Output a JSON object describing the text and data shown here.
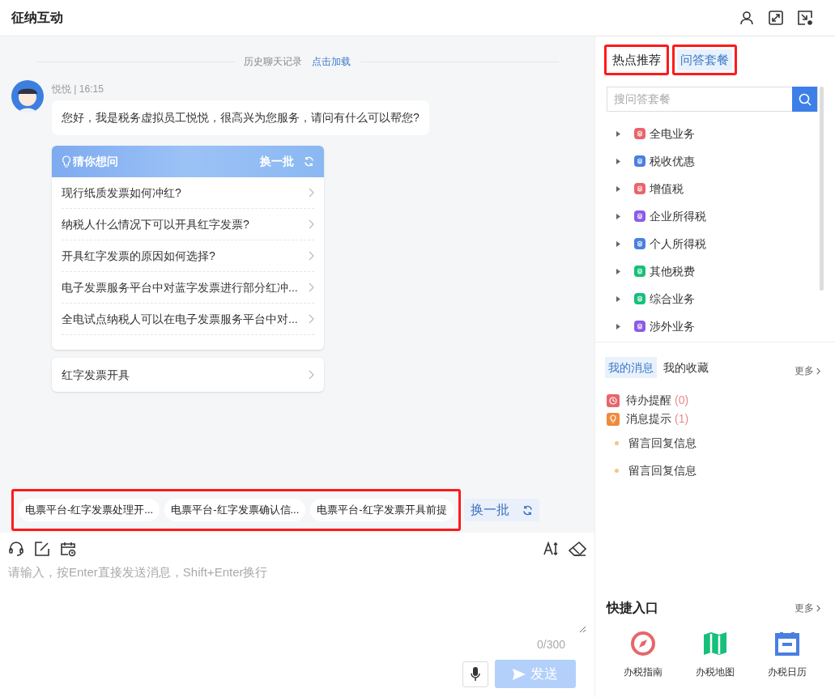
{
  "window": {
    "title": "征纳互动"
  },
  "chat": {
    "history_label": "历史聊天记录",
    "history_link": "点击加载",
    "message": {
      "sender": "悦悦 | 16:15",
      "text": "您好，我是税务虚拟员工悦悦，很高兴为您服务，请问有什么可以帮您?"
    },
    "suggest_card": {
      "title": "猜你想问",
      "refresh": "换一批",
      "questions": [
        "现行纸质发票如何冲红?",
        "纳税人什么情况下可以开具红字发票?",
        "开具红字发票的原因如何选择?",
        "电子发票服务平台中对蓝字发票进行部分红冲...",
        "全电试点纳税人可以在电子发票服务平台中对..."
      ]
    },
    "topic_card": {
      "text": "红字发票开具"
    }
  },
  "quick_chips": {
    "highlighted": true,
    "items": [
      "电票平台-红字发票处理开...",
      "电票平台-红字发票确认信...",
      "电票平台-红字发票开具前提"
    ],
    "refresh": "换一批"
  },
  "composer": {
    "placeholder": "请输入，按Enter直接发送消息，Shift+Enter换行",
    "counter": "0/300",
    "send": "发送",
    "send_disabled": true
  },
  "sidebar": {
    "tabs": [
      {
        "label": "热点推荐",
        "selected": false,
        "highlighted": true
      },
      {
        "label": "问答套餐",
        "selected": true,
        "highlighted": true
      }
    ],
    "search": {
      "placeholder": "搜问答套餐"
    },
    "tree": [
      {
        "label": "全电业务",
        "color": "#e8656b",
        "expanded": false
      },
      {
        "label": "税收优惠",
        "color": "#4a7fe0",
        "expanded": false
      },
      {
        "label": "增值税",
        "color": "#e8656b",
        "expanded": false
      },
      {
        "label": "企业所得税",
        "color": "#8a5ce6",
        "expanded": false
      },
      {
        "label": "个人所得税",
        "color": "#4a7fe0",
        "expanded": false
      },
      {
        "label": "其他税费",
        "color": "#16c07a",
        "expanded": false
      },
      {
        "label": "综合业务",
        "color": "#16c07a",
        "expanded": false
      },
      {
        "label": "涉外业务",
        "color": "#8a5ce6",
        "expanded": false
      }
    ],
    "message_tabs": [
      {
        "label": "我的消息",
        "selected": true
      },
      {
        "label": "我的收藏",
        "selected": false
      }
    ],
    "messages_more": "更多",
    "messages": [
      {
        "kind": "category",
        "label": "待办提醒",
        "count": "(0)",
        "color": "#e8656b"
      },
      {
        "kind": "category",
        "label": "消息提示",
        "count": "(1)",
        "color": "#f08a3c"
      },
      {
        "kind": "entry",
        "label": "留言回复信息"
      },
      {
        "kind": "entry",
        "label": "留言回复信息"
      }
    ],
    "shortcuts_title": "快捷入口",
    "shortcuts_more": "更多",
    "shortcuts": [
      {
        "label": "办税指南",
        "kind": "compass",
        "color": "#e8656b"
      },
      {
        "label": "办税地图",
        "kind": "map",
        "color": "#16c07a"
      },
      {
        "label": "办税日历",
        "kind": "calendar",
        "color": "#4a7fe0"
      }
    ]
  }
}
